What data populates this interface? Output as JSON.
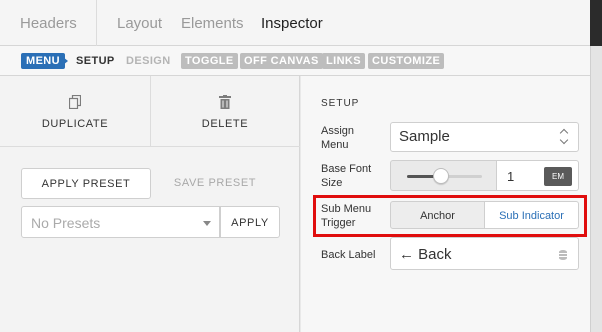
{
  "top_tabs": [
    {
      "label": "Headers",
      "active": false
    },
    {
      "label": "Layout",
      "active": false
    },
    {
      "label": "Elements",
      "active": false
    },
    {
      "label": "Inspector",
      "active": true
    }
  ],
  "sub_nav": {
    "menu": "MENU",
    "setup": "SETUP",
    "design": "DESIGN",
    "toggle": "TOGGLE",
    "off_canvas": "OFF CANVAS",
    "links": "LINKS",
    "customize": "CUSTOMIZE"
  },
  "left_panel": {
    "duplicate_label": "DUPLICATE",
    "delete_label": "DELETE",
    "apply_preset_label": "APPLY PRESET",
    "save_preset_label": "SAVE PRESET",
    "presets_placeholder": "No Presets",
    "apply_label": "APPLY"
  },
  "setup": {
    "title": "SETUP",
    "assign_menu_label": "Assign Menu",
    "assign_menu_value": "Sample",
    "base_font_size_label": "Base Font Size",
    "base_font_size_value": "1",
    "base_font_size_unit": "EM",
    "slider_level": 0.45,
    "sub_menu_trigger_label": "Sub Menu Trigger",
    "trigger_options": [
      "Anchor",
      "Sub Indicator"
    ],
    "trigger_selected": "Sub Indicator",
    "back_label_label": "Back Label",
    "back_label_value": "← Back"
  },
  "icons": {
    "duplicate": "duplicate-icon",
    "delete": "trash-icon",
    "dynamic_data": "database-icon"
  },
  "colors": {
    "accent": "#2a6fb6",
    "highlight": "#e00d0d",
    "pill_gray": "#bdbdbd"
  }
}
